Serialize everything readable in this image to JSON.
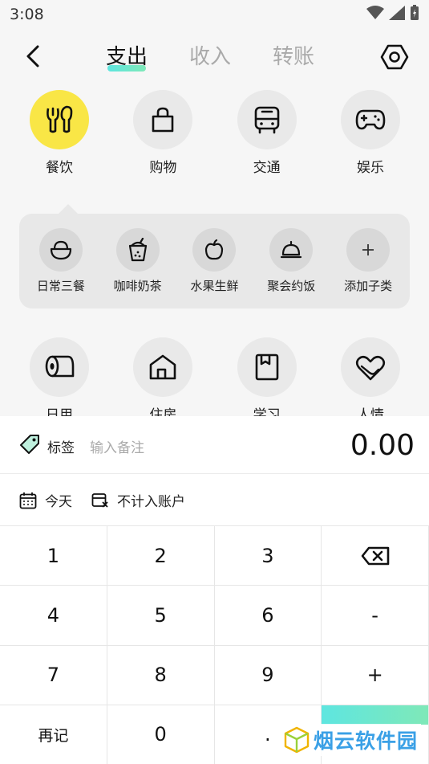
{
  "status_bar": {
    "time": "3:08"
  },
  "header": {
    "tabs": [
      {
        "label": "支出",
        "active": true
      },
      {
        "label": "收入",
        "active": false
      },
      {
        "label": "转账",
        "active": false
      }
    ]
  },
  "categories": {
    "row1": [
      {
        "label": "餐饮",
        "icon": "utensils-icon",
        "selected": true
      },
      {
        "label": "购物",
        "icon": "shopping-bag-icon",
        "selected": false
      },
      {
        "label": "交通",
        "icon": "bus-icon",
        "selected": false
      },
      {
        "label": "娱乐",
        "icon": "gamepad-icon",
        "selected": false
      }
    ],
    "row2": [
      {
        "label": "日用",
        "icon": "toilet-paper-icon"
      },
      {
        "label": "住房",
        "icon": "house-icon"
      },
      {
        "label": "学习",
        "icon": "book-icon"
      },
      {
        "label": "人情",
        "icon": "heart-hand-icon"
      }
    ]
  },
  "subcategories": [
    {
      "label": "日常三餐",
      "icon": "rice-bowl-icon"
    },
    {
      "label": "咖啡奶茶",
      "icon": "bubble-tea-icon"
    },
    {
      "label": "水果生鲜",
      "icon": "apple-icon"
    },
    {
      "label": "聚会约饭",
      "icon": "dish-cover-icon"
    },
    {
      "label": "添加子类",
      "icon": "plus-icon"
    }
  ],
  "entry": {
    "tag_label": "标签",
    "remark_placeholder": "输入备注",
    "amount": "0.00",
    "date_label": "今天",
    "account_label": "不计入账户"
  },
  "keypad": {
    "keys": [
      "1",
      "2",
      "3",
      "",
      "4",
      "5",
      "6",
      "-",
      "7",
      "8",
      "9",
      "+",
      "再记",
      "0",
      ".",
      ""
    ]
  },
  "watermark": {
    "text": "烟云软件园"
  },
  "colors": {
    "accent_yellow": "#f9e646",
    "accent_teal": "#5ee6e0",
    "accent_green": "#7fe8b8"
  }
}
